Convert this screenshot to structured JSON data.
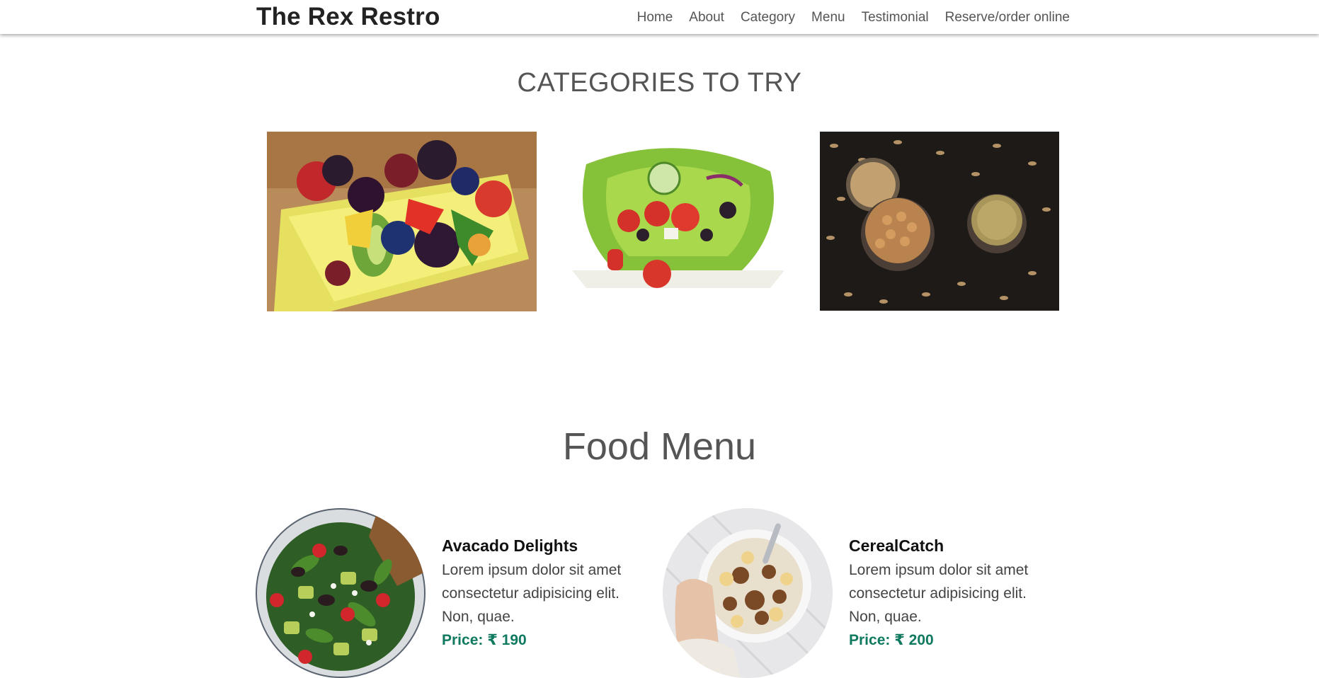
{
  "navbar": {
    "brand": "The Rex Restro",
    "links": [
      "Home",
      "About",
      "Category",
      "Menu",
      "Testimonial",
      "Reserve/order online"
    ]
  },
  "categories": {
    "title": "CATEGORIES TO TRY",
    "images": [
      "fruit-salad-image",
      "vegetable-salad-image",
      "grains-pulses-image"
    ]
  },
  "food_menu": {
    "title": "Food Menu",
    "items": [
      {
        "name": "Avacado Delights",
        "description": "Lorem ipsum dolor sit amet consectetur adipisicing elit. Non, quae.",
        "price": "Price: ₹ 190"
      },
      {
        "name": "CerealCatch",
        "description": "Lorem ipsum dolor sit amet consectetur adipisicing elit. Non, quae.",
        "price": "Price: ₹ 200"
      }
    ]
  },
  "colors": {
    "price_green": "#0f7a5f",
    "heading_gray": "#555555",
    "brand_dark": "#222222"
  }
}
